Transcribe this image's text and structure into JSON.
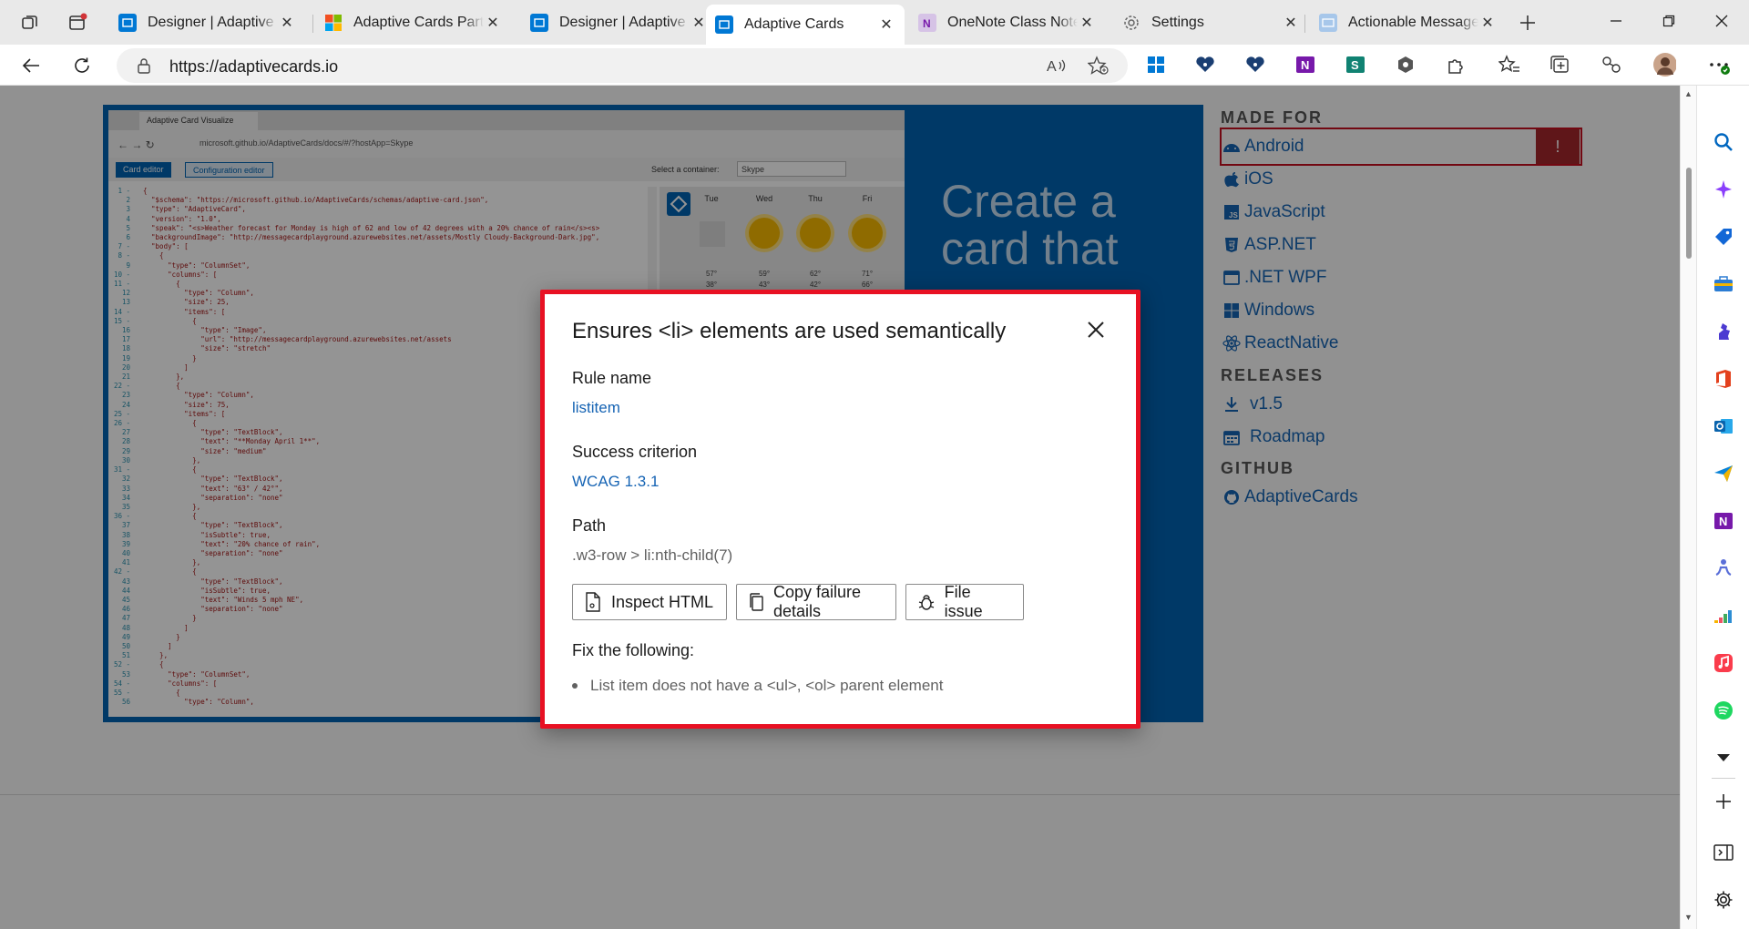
{
  "tabs": [
    {
      "title": "Designer | Adaptive Cards",
      "favicon": "designer-icon",
      "color": "#0078d4"
    },
    {
      "title": "Adaptive Cards Partners",
      "favicon": "microsoft-logo-icon",
      "color": "#f25022"
    },
    {
      "title": "Designer | Adaptive Cards",
      "favicon": "designer-icon",
      "color": "#0078d4"
    },
    {
      "title": "Adaptive Cards",
      "favicon": "adaptive-cards-icon",
      "color": "#0078d4",
      "active": true
    },
    {
      "title": "OneNote Class Notebook",
      "favicon": "onenote-icon",
      "color": "#7719aa"
    },
    {
      "title": "Settings",
      "favicon": "gear-icon",
      "color": "#555555"
    },
    {
      "title": "Actionable Messages",
      "favicon": "mail-icon",
      "color": "#0078d4"
    }
  ],
  "address": {
    "url": "https://adaptivecards.io"
  },
  "hero": {
    "inner_tab_title": "Adaptive Card Visualize",
    "inner_url": "microsoft.github.io/AdaptiveCards/docs/#/?hostApp=Skype",
    "card_editor_label": "Card editor",
    "config_editor_label": "Configuration editor",
    "container_label": "Select a container:",
    "container_value": "Skype",
    "days": [
      "Tue",
      "Wed",
      "Thu",
      "Fri"
    ],
    "temps_high": [
      "57°",
      "59°",
      "62°",
      "71°"
    ],
    "temps_low": [
      "38°",
      "43°",
      "42°",
      "66°"
    ],
    "headline_line1": "Create a",
    "headline_line2": "card that",
    "code_lines": [
      "{",
      "  \"$schema\": \"https://microsoft.github.io/AdaptiveCards/schemas/adaptive-card.json\",",
      "  \"type\": \"AdaptiveCard\",",
      "  \"version\": \"1.0\",",
      "  \"speak\": \"<s>Weather forecast for Monday is high of 62 and low of 42 degrees with a 20% chance of rain</s><s>",
      "  \"backgroundImage\": \"http://messagecardplayground.azurewebsites.net/assets/Mostly Cloudy-Background-Dark.jpg\",",
      "  \"body\": [",
      "    {",
      "      \"type\": \"ColumnSet\",",
      "      \"columns\": [",
      "        {",
      "          \"type\": \"Column\",",
      "          \"size\": 25,",
      "          \"items\": [",
      "            {",
      "              \"type\": \"Image\",",
      "              \"url\": \"http://messagecardplayground.azurewebsites.net/assets",
      "              \"size\": \"stretch\"",
      "            }",
      "          ]",
      "        },",
      "        {",
      "          \"type\": \"Column\",",
      "          \"size\": 75,",
      "          \"items\": [",
      "            {",
      "              \"type\": \"TextBlock\",",
      "              \"text\": \"**Monday April 1**\",",
      "              \"size\": \"medium\"",
      "            },",
      "            {",
      "              \"type\": \"TextBlock\",",
      "              \"text\": \"63° / 42°\",",
      "              \"separation\": \"none\"",
      "            },",
      "            {",
      "              \"type\": \"TextBlock\",",
      "              \"isSubtle\": true,",
      "              \"text\": \"20% chance of rain\",",
      "              \"separation\": \"none\"",
      "            },",
      "            {",
      "              \"type\": \"TextBlock\",",
      "              \"isSubtle\": true,",
      "              \"text\": \"Winds 5 mph NE\",",
      "              \"separation\": \"none\"",
      "            }",
      "          ]",
      "        }",
      "      ]",
      "    },",
      "    {",
      "      \"type\": \"ColumnSet\",",
      "      \"columns\": [",
      "        {",
      "          \"type\": \"Column\","
    ]
  },
  "sidebar": {
    "made_for_title": "MADE FOR",
    "made_for": [
      "Android",
      "iOS",
      "JavaScript",
      "ASP.NET",
      ".NET WPF",
      "Windows",
      "ReactNative"
    ],
    "android_flag": "!",
    "releases_title": "RELEASES",
    "releases": [
      "v1.5",
      "Roadmap"
    ],
    "github_title": "GITHUB",
    "github": [
      "AdaptiveCards"
    ]
  },
  "dialog": {
    "title": "Ensures <li> elements are used semantically",
    "rule_label": "Rule name",
    "rule_value": "listitem",
    "criterion_label": "Success criterion",
    "criterion_value": "WCAG 1.3.1",
    "path_label": "Path",
    "path_value": ".w3-row > li:nth-child(7)",
    "inspect_label": "Inspect HTML",
    "copy_label": "Copy failure details",
    "file_label": "File issue",
    "fix_label": "Fix the following:",
    "fix_items": [
      "List item does not have a <ul>, <ol> parent element"
    ]
  },
  "colors": {
    "accent": "#1664b4",
    "dialog_border": "#e81123",
    "hero_blue": "#0063b1",
    "flag_red": "#a4262c"
  }
}
